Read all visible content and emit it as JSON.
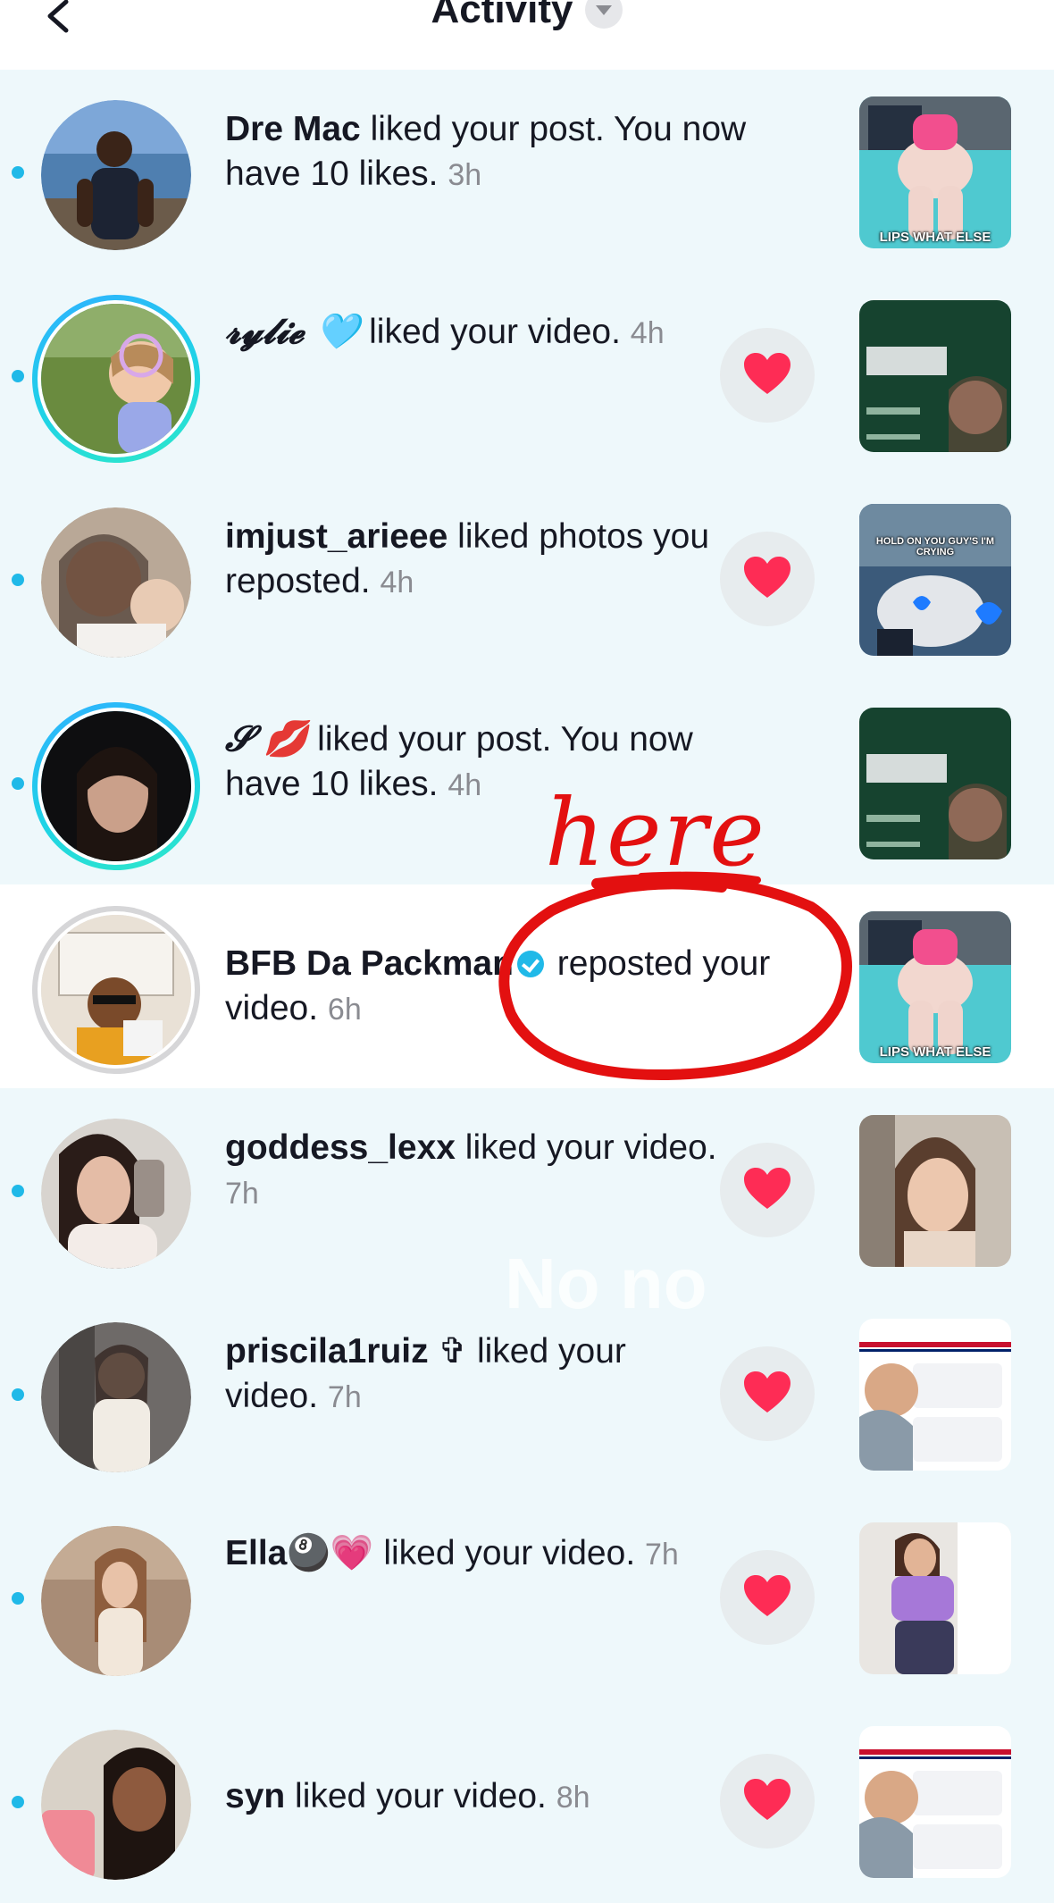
{
  "header": {
    "title": "Activity",
    "back_icon": "chevron-left-icon",
    "dropdown_icon": "chevron-down-icon"
  },
  "colors": {
    "unread_bg": "#eef8fb",
    "read_bg": "#ffffff",
    "unread_dot": "#20b9e8",
    "heart": "#fe2c55",
    "annotation": "#e31010"
  },
  "notifications": [
    {
      "username": "Dre Mac",
      "action": " liked your post. You now have 10 likes.",
      "time": "3h",
      "unread": true,
      "like_button": false,
      "thumb_caption": "LIPS WHAT ELSE"
    },
    {
      "username": "𝓻𝔂𝓵𝓲𝓮 🩵",
      "action": " liked your video.",
      "time": "4h",
      "unread": true,
      "like_button": true,
      "thumb_caption": ""
    },
    {
      "username": "imjust_arieee",
      "action": " liked photos you reposted.",
      "time": "4h",
      "unread": true,
      "like_button": true,
      "thumb_caption": "HOLD ON YOU GUY'S I'M CRYING"
    },
    {
      "username": "𝓢 💋",
      "action": " liked your post. You now have 10 likes.",
      "time": "4h",
      "unread": true,
      "like_button": false,
      "thumb_caption": ""
    },
    {
      "username": "BFB Da Packman",
      "action": " reposted your video.",
      "time": "6h",
      "unread": false,
      "verified": true,
      "like_button": false,
      "thumb_caption": "LIPS WHAT ELSE"
    },
    {
      "username": "goddess_lexx",
      "action": " liked your video.",
      "time": "7h",
      "unread": true,
      "like_button": true,
      "thumb_caption": ""
    },
    {
      "username": "priscila1ruiz ✞",
      "action": " liked your video.",
      "time": "7h",
      "unread": true,
      "like_button": true,
      "thumb_caption": ""
    },
    {
      "username": "Ella🎱💗",
      "action": " liked your video.",
      "time": "7h",
      "unread": true,
      "like_button": true,
      "thumb_caption": ""
    },
    {
      "username": "syn",
      "action": " liked your video.",
      "time": "8h",
      "unread": true,
      "like_button": true,
      "thumb_caption": ""
    }
  ],
  "overlays": {
    "handwritten": "here",
    "watermark": "No no"
  }
}
